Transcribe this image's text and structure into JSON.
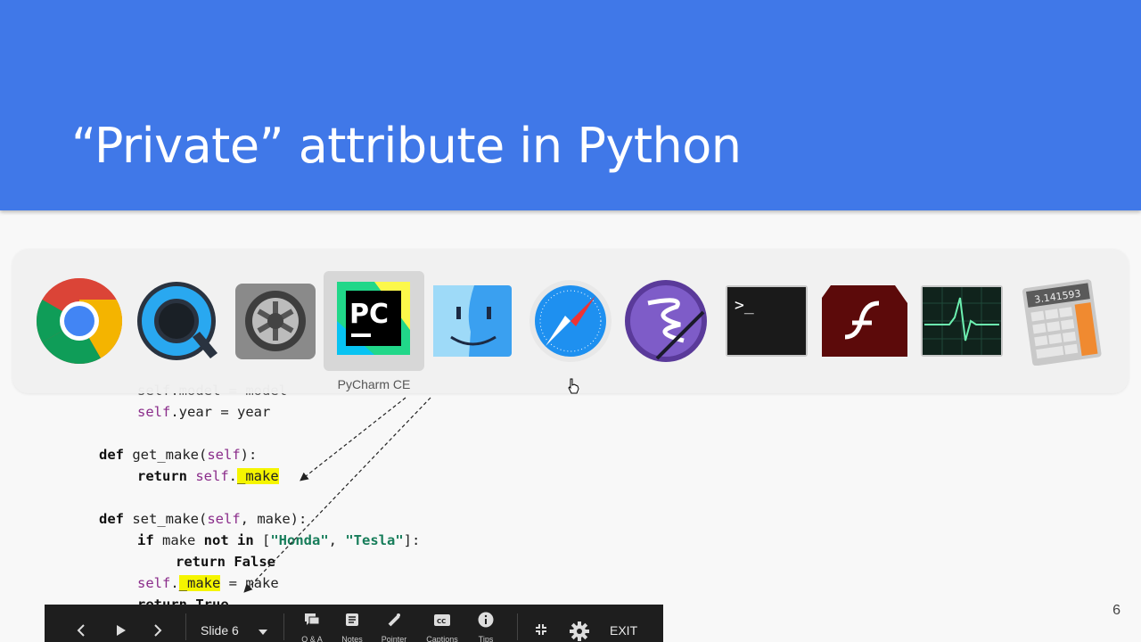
{
  "slide": {
    "title": "“Private” attribute in Python",
    "page_number": "6"
  },
  "code": {
    "l0_obscured": "self.model = model",
    "l1_self": "self",
    "l1_rest": ".year = year",
    "l2_def": "def",
    "l2_sig_a": " get_make(",
    "l2_self": "self",
    "l2_sig_b": "):",
    "l3_return": "return",
    "l3_self": " self",
    "l3_dot": ".",
    "l3_attr": "_make",
    "l4_def": "def",
    "l4_sig_a": " set_make(",
    "l4_self": "self",
    "l4_sig_b": ", make):",
    "l5_if": "if",
    "l5_a": " make ",
    "l5_notin": "not in",
    "l5_b": " [",
    "l5_s1": "\"Honda\"",
    "l5_c": ", ",
    "l5_s2": "\"Tesla\"",
    "l5_d": "]:",
    "l6_return": "return",
    "l6_false": " False",
    "l7_self": "self",
    "l7_dot": ".",
    "l7_attr": "_make",
    "l7_rest": " = make",
    "l8_obscured": "return True"
  },
  "dock": {
    "apps": [
      {
        "name": "Google Chrome",
        "icon": "chrome-icon"
      },
      {
        "name": "QuickTime Player",
        "icon": "quicktime-icon"
      },
      {
        "name": "System Preferences",
        "icon": "system-preferences-icon"
      },
      {
        "name": "PyCharm CE",
        "icon": "pycharm-icon"
      },
      {
        "name": "Finder",
        "icon": "finder-icon"
      },
      {
        "name": "Safari",
        "icon": "safari-icon"
      },
      {
        "name": "Emacs",
        "icon": "emacs-icon"
      },
      {
        "name": "Terminal",
        "icon": "terminal-icon"
      },
      {
        "name": "Flash Player",
        "icon": "flash-icon"
      },
      {
        "name": "Activity Monitor",
        "icon": "activity-monitor-icon"
      },
      {
        "name": "Calculator",
        "icon": "calculator-icon"
      }
    ],
    "hover_label": "PyCharm CE",
    "terminal_prompt": ">_",
    "calculator_display": "3.141593",
    "pycharm_text": "PC"
  },
  "toolbar": {
    "slide_label": "Slide 6",
    "qa_label": "Q & A",
    "notes_label": "Notes",
    "pointer_label": "Pointer",
    "captions_label": "Captions",
    "tips_label": "Tips",
    "exit_label": "EXIT"
  },
  "colors": {
    "header": "#4078e8",
    "highlight": "#f5f500",
    "toolbar": "#1e1e1e"
  }
}
